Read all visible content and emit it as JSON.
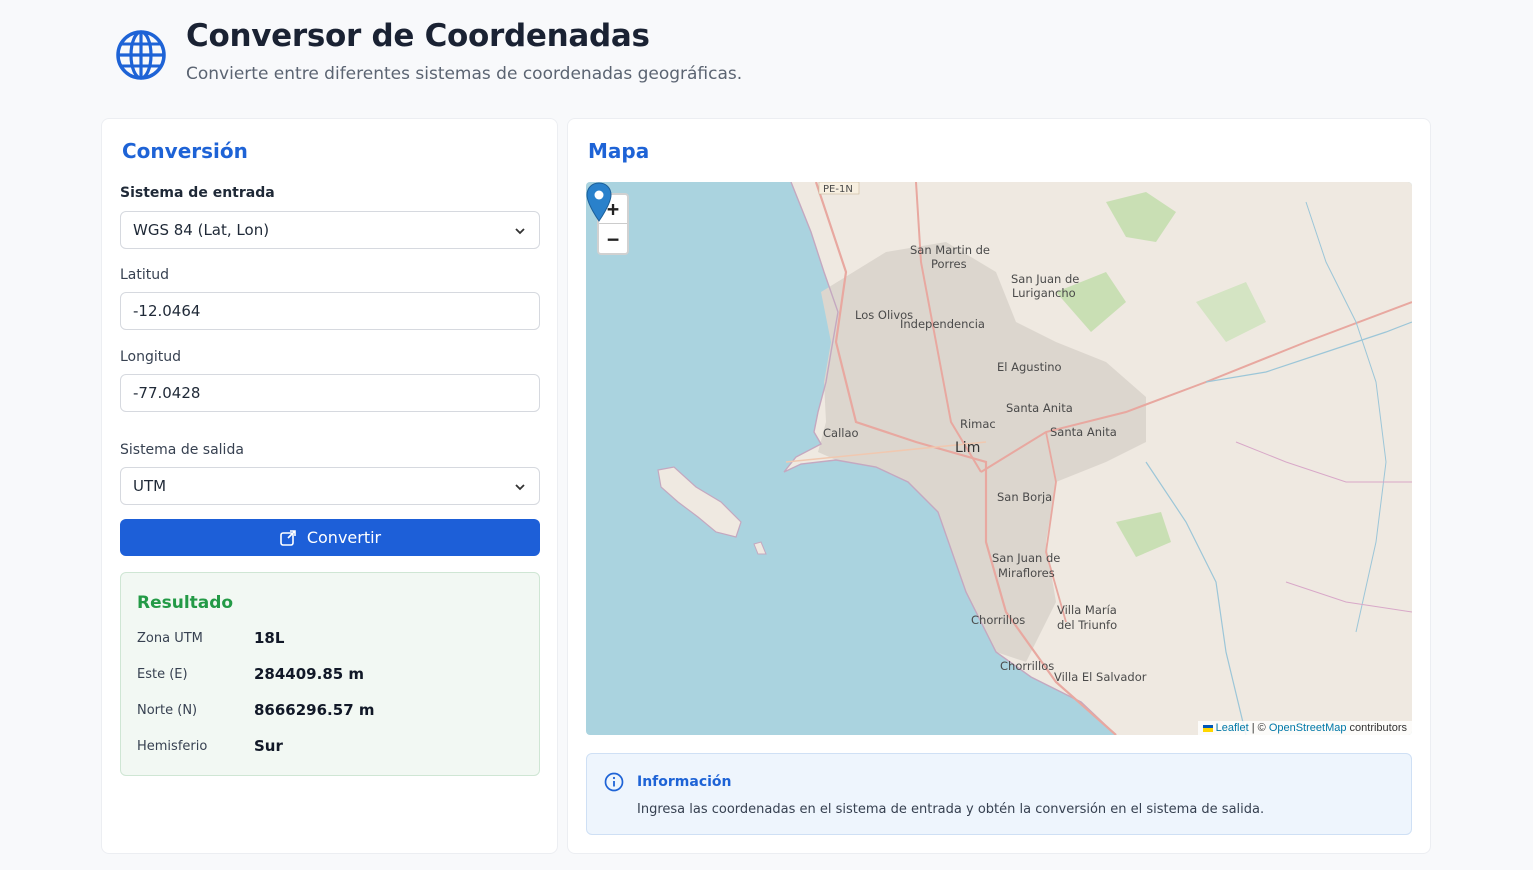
{
  "header": {
    "title": "Conversor de Coordenadas",
    "subtitle": "Convierte entre diferentes sistemas de coordenadas geográficas.",
    "icon": "globe-icon"
  },
  "conversion": {
    "title": "Conversión",
    "input_system_label": "Sistema de entrada",
    "input_system_value": "WGS 84 (Lat, Lon)",
    "lat_label": "Latitud",
    "lat_value": "-12.0464",
    "lon_label": "Longitud",
    "lon_value": "-77.0428",
    "output_system_label": "Sistema de salida",
    "output_system_value": "UTM",
    "convert_label": "Convertir"
  },
  "result": {
    "title": "Resultado",
    "rows": [
      {
        "key": "Zona UTM",
        "value": "18L"
      },
      {
        "key": "Este (E)",
        "value": "284409.85 m"
      },
      {
        "key": "Norte (N)",
        "value": "8666296.57 m"
      },
      {
        "key": "Hemisferio",
        "value": "Sur"
      }
    ]
  },
  "map": {
    "title": "Mapa",
    "zoom_in": "+",
    "zoom_out": "−",
    "attribution_leaflet": "Leaflet",
    "attribution_sep": " | © ",
    "attribution_osm": "OpenStreetMap",
    "attribution_tail": " contributors",
    "places": {
      "pe1n": "PE-1N",
      "smp1": "San Martin de",
      "smp2": "Porres",
      "sjl1": "San Juan de",
      "sjl2": "Lurigancho",
      "olivos": "Los Olivos",
      "indep": "Independencia",
      "agustino": "El Agustino",
      "sanluis": "Santa Anita",
      "santaanita": "Santa Anita",
      "rimac": "Rimac",
      "callao": "Callao",
      "lima": "Lim",
      "borja": "San Borja",
      "sjm1": "San Juan de",
      "sjm2": "Miraflores",
      "vmt1": "Villa María",
      "vmt2": "del Triunfo",
      "chorrillos": "Chorrillos",
      "chorrillos2": "Chorrillos",
      "ves": "Villa El Salvador"
    },
    "colors": {
      "sea": "#aad3df",
      "land": "#efe9e1",
      "urban": "#dcd6ce",
      "green": "#c9dfb4",
      "pin": "#2a81cb"
    }
  },
  "info": {
    "title": "Información",
    "text": "Ingresa las coordenadas en el sistema de entrada y obtén la conversión en el sistema de salida."
  }
}
